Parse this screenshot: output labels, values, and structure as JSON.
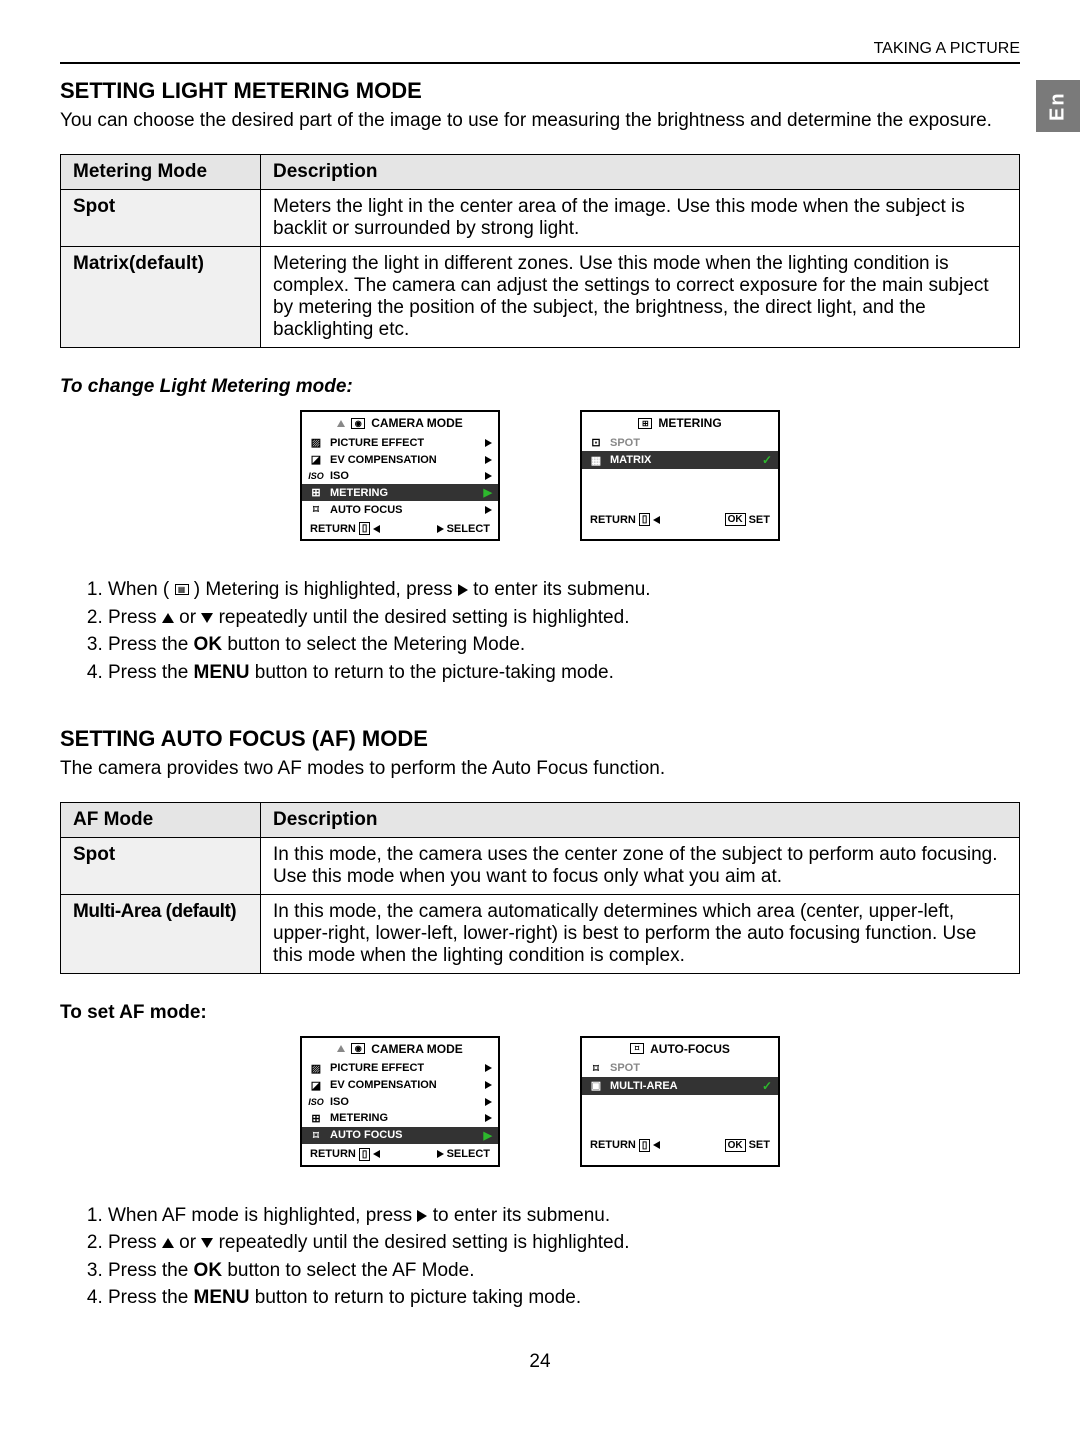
{
  "header": {
    "section": "TAKING A PICTURE",
    "lang_tab": "En",
    "page_number": "24"
  },
  "section1": {
    "title": "SETTING LIGHT METERING MODE",
    "intro": "You can choose the desired part of the image to use for measuring the brightness and determine the exposure.",
    "table": {
      "col1": "Metering Mode",
      "col2": "Description",
      "rows": [
        {
          "mode": "Spot",
          "desc": "Meters the light in the center area of the image. Use this mode when the subject is backlit or surrounded by strong light."
        },
        {
          "mode": "Matrix(default)",
          "desc": "Metering the light in different zones. Use this mode when the lighting condition is complex. The camera can adjust the settings to correct exposure for the main subject by metering the position of the subject, the brightness, the direct light, and the backlighting etc."
        }
      ]
    },
    "subhead": "To change Light Metering mode:",
    "menu1": {
      "title": "CAMERA MODE",
      "items": [
        {
          "label": "PICTURE EFFECT"
        },
        {
          "label": "EV COMPENSATION"
        },
        {
          "label": "ISO"
        },
        {
          "label": "METERING",
          "hl": true
        },
        {
          "label": "AUTO FOCUS"
        }
      ],
      "footer_left": "RETURN",
      "footer_right": "SELECT"
    },
    "menu2": {
      "title": "METERING",
      "items": [
        {
          "label": "SPOT"
        },
        {
          "label": "MATRIX",
          "hl": true,
          "check": true
        }
      ],
      "footer_left": "RETURN",
      "footer_right_box": "OK",
      "footer_right": "SET"
    },
    "steps": [
      {
        "pre": "When ( ",
        "icon": "matrix-icon",
        "mid": " ) Metering is highlighted, press ",
        "arrow": "right",
        "post": " to enter its submenu."
      },
      {
        "pre": "Press ",
        "arrow1": "up",
        "mid": " or ",
        "arrow2": "down",
        "post": " repeatedly until the desired setting is highlighted."
      },
      {
        "pre": "Press the ",
        "bold": "OK",
        "post": " button to select the Metering Mode."
      },
      {
        "pre": "Press the ",
        "bold": "MENU",
        "post": " button to return to the picture-taking mode."
      }
    ]
  },
  "section2": {
    "title": "SETTING AUTO FOCUS (AF) MODE",
    "intro": "The camera provides two AF modes to perform the Auto Focus function.",
    "table": {
      "col1": "AF Mode",
      "col2": "Description",
      "rows": [
        {
          "mode": "Spot",
          "desc": "In this mode, the camera uses the center zone of the subject to perform auto focusing. Use this mode when you want to focus only what you aim at."
        },
        {
          "mode": "Multi-Area (default)",
          "desc": "In this mode, the camera automatically determines which area (center, upper-left, upper-right, lower-left, lower-right) is best to perform the auto focusing function. Use this mode when the lighting condition is complex."
        }
      ]
    },
    "subhead": "To set AF mode:",
    "menu1": {
      "title": "CAMERA MODE",
      "items": [
        {
          "label": "PICTURE EFFECT"
        },
        {
          "label": "EV COMPENSATION"
        },
        {
          "label": "ISO"
        },
        {
          "label": "METERING"
        },
        {
          "label": "AUTO FOCUS",
          "hl": true
        }
      ],
      "footer_left": "RETURN",
      "footer_right": "SELECT"
    },
    "menu2": {
      "title": "AUTO-FOCUS",
      "items": [
        {
          "label": "SPOT"
        },
        {
          "label": "MULTI-AREA",
          "hl": true,
          "check": true
        }
      ],
      "footer_left": "RETURN",
      "footer_right_box": "OK",
      "footer_right": "SET"
    },
    "steps": [
      {
        "pre": "When AF mode is highlighted, press ",
        "arrow": "right",
        "post": " to enter its submenu."
      },
      {
        "pre": "Press ",
        "arrow1": "up",
        "mid": " or ",
        "arrow2": "down",
        "post": " repeatedly until the desired setting is highlighted."
      },
      {
        "pre": "Press the ",
        "bold": "OK",
        "post": " button to select the AF Mode."
      },
      {
        "pre": "Press the ",
        "bold": "MENU",
        "post": " button to return to picture taking mode."
      }
    ]
  }
}
